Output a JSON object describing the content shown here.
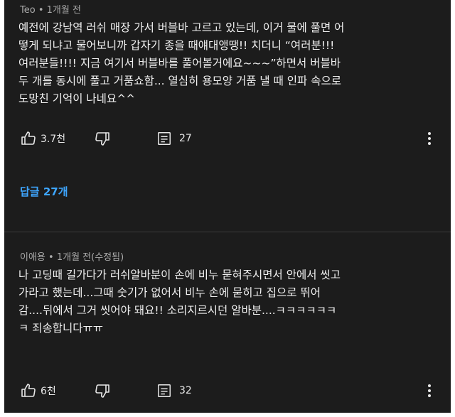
{
  "comments": [
    {
      "author": "Teo",
      "separator": "•",
      "time": "1개월 전",
      "lines": [
        "예전에 강남역 러쉬 매장 가서 버블바 고르고 있는데, 이거 물에 풀면 어",
        "떻게 되냐고 물어보니까 갑자기 종을 때얘대앵땡!! 치더니 “여러분!!!",
        "여러분들!!!! 지금 여기서 버블바를 풀어볼거에요~~~”하면서 버블바",
        "두 개를 동시에 풀고 거품쇼함... 열심히 용모양 거품 낼 때 인파 속으로",
        "도망친 기억이 나네요^^"
      ],
      "likes": "3.7천",
      "replies_count": "27",
      "replies_link": "답글 27개"
    },
    {
      "author": "이애용",
      "separator": "•",
      "time": "1개월 전(수정됨)",
      "lines": [
        "나 고딩때 길가다가 러쉬알바분이 손에 비누 묻혀주시면서 안에서 씻고",
        "가라고 했는데...그때 숫기가 없어서 비누 손에 묻히고 집으로 뛰어",
        "감....뒤에서 그거 씻어야 돼요!! 소리지르시던 알바분....ㅋㅋㅋㅋㅋㅋ",
        "ㅋ 죄송합니다ㅠㅠ"
      ],
      "likes": "6천",
      "replies_count": "32"
    }
  ],
  "icons": {
    "like": "thumbs-up-icon",
    "dislike": "thumbs-down-icon",
    "reply": "comment-icon",
    "more": "more-vert-icon"
  },
  "colors": {
    "background": "#1c1c1c",
    "text": "#f1f1f1",
    "meta": "#aaaaaa",
    "link": "#3ea6ff"
  }
}
